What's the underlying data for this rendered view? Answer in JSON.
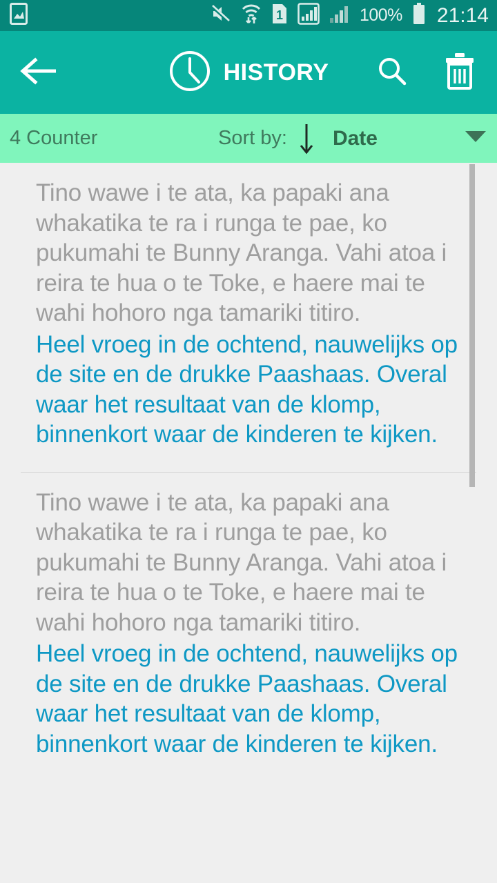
{
  "status_bar": {
    "icons": [
      "image-gallery-icon",
      "mute-icon",
      "wifi-transfer-icon",
      "sim-1-icon",
      "signal-1-icon",
      "signal-2-icon"
    ],
    "battery_percent": "100%",
    "battery_icon": "battery-full-icon",
    "time": "21:14",
    "background": "#06867a"
  },
  "app_bar": {
    "back_icon": "back-arrow-icon",
    "title_icon": "clock-icon",
    "title": "HISTORY",
    "search_icon": "search-icon",
    "delete_icon": "trash-icon",
    "background": "#0bb3a2"
  },
  "sort_bar": {
    "counter": "4 Counter",
    "sort_label": "Sort by:",
    "sort_direction_icon": "arrow-down-icon",
    "sort_value": "Date",
    "dropdown_icon": "caret-down-icon",
    "background": "#80f5bc"
  },
  "list": {
    "source_color": "#9e9e9e",
    "target_color": "#0e98c4",
    "items": [
      {
        "source_text": "Tino wawe i te ata, ka papaki ana whakatika te ra i runga te pae, ko pukumahi te Bunny Aranga. Vahi atoa i reira te hua o te Toke, e haere mai te wahi hohoro nga tamariki titiro.",
        "target_text": "Heel vroeg in de ochtend, nauwelijks op de site en de drukke Paashaas. Overal waar het resultaat van de klomp, binnenkort waar de kinderen te kijken."
      },
      {
        "source_text": "Tino wawe i te ata, ka papaki ana whakatika te ra i runga te pae, ko pukumahi te Bunny Aranga. Vahi atoa i reira te hua o te Toke, e haere mai te wahi hohoro nga tamariki titiro.",
        "target_text": "Heel vroeg in de ochtend, nauwelijks op de site en de drukke Paashaas. Overal waar het resultaat van de klomp, binnenkort waar de kinderen te kijken."
      }
    ],
    "scrollbar_visible": true
  }
}
